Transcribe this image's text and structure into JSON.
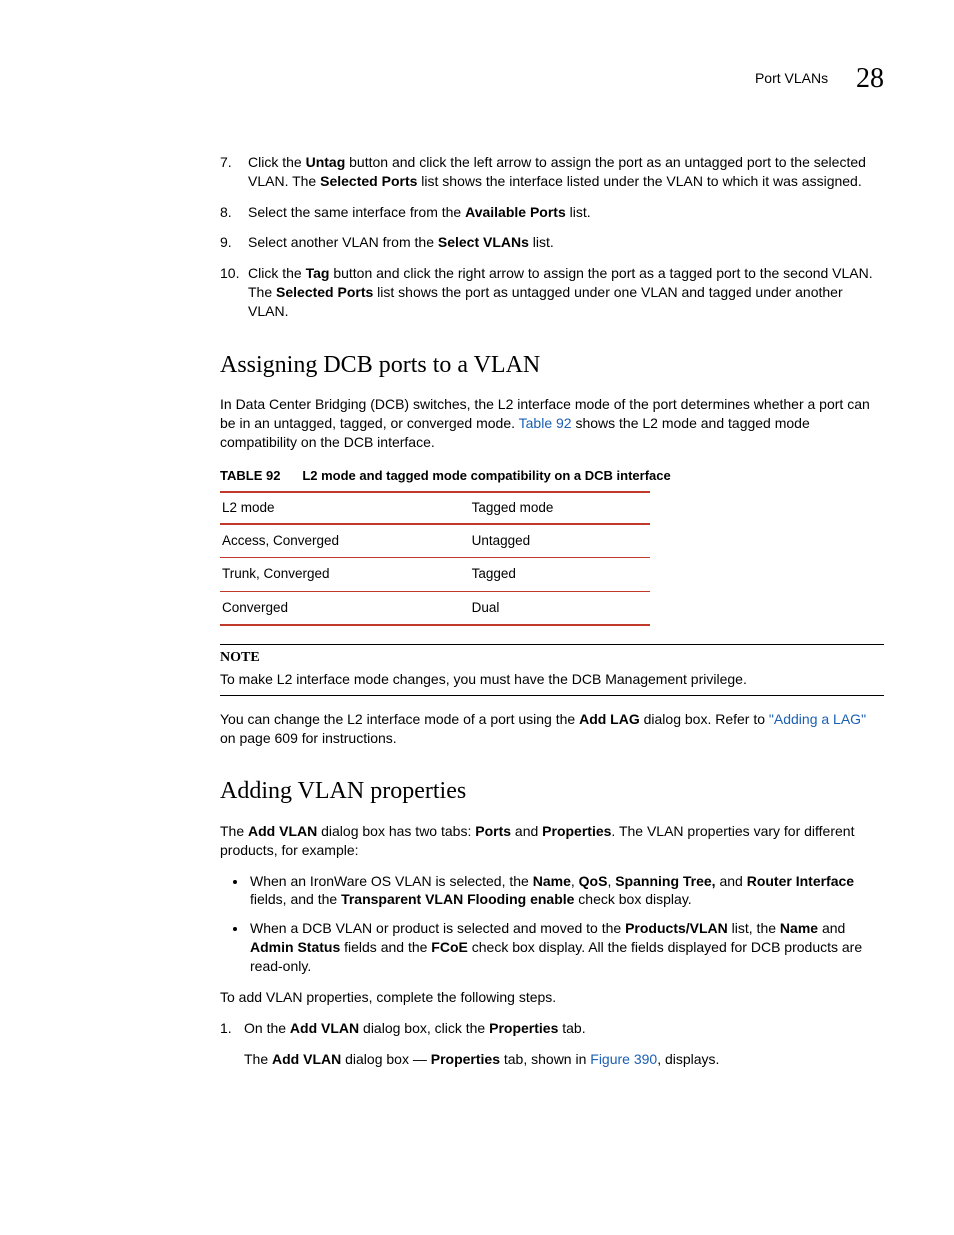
{
  "header": {
    "section": "Port VLANs",
    "chapter": "28"
  },
  "steps": [
    {
      "n": "7.",
      "parts": [
        {
          "t": "Click the "
        },
        {
          "t": "Untag",
          "b": true
        },
        {
          "t": " button and click the left arrow to assign the port as an untagged port to the selected VLAN. The "
        },
        {
          "t": "Selected Ports",
          "b": true
        },
        {
          "t": " list shows the interface listed under the VLAN to which it was assigned."
        }
      ]
    },
    {
      "n": "8.",
      "parts": [
        {
          "t": "Select the same interface from the "
        },
        {
          "t": "Available Ports",
          "b": true
        },
        {
          "t": " list."
        }
      ]
    },
    {
      "n": "9.",
      "parts": [
        {
          "t": "Select another VLAN from the "
        },
        {
          "t": "Select VLANs",
          "b": true
        },
        {
          "t": " list."
        }
      ]
    },
    {
      "n": "10.",
      "parts": [
        {
          "t": "Click the "
        },
        {
          "t": "Tag",
          "b": true
        },
        {
          "t": " button and click the right arrow to assign the port as a tagged port to the second VLAN. The "
        },
        {
          "t": "Selected Ports",
          "b": true
        },
        {
          "t": " list shows the port as untagged under one VLAN and tagged under another VLAN."
        }
      ]
    }
  ],
  "sec1": {
    "title": "Assigning DCB ports to a VLAN",
    "intro_parts": [
      {
        "t": "In Data Center Bridging (DCB) switches, the L2 interface mode of the port determines whether a port can be in an untagged, tagged, or converged mode. "
      },
      {
        "t": "Table 92",
        "link": true
      },
      {
        "t": " shows the L2 mode and tagged mode compatibility on the DCB interface."
      }
    ],
    "table": {
      "label": "TABLE 92",
      "caption": "L2 mode and tagged mode compatibility on a DCB interface",
      "head": [
        "L2 mode",
        "Tagged mode"
      ],
      "rows": [
        [
          "Access, Converged",
          "Untagged"
        ],
        [
          "Trunk, Converged",
          "Tagged"
        ],
        [
          "Converged",
          "Dual"
        ]
      ]
    },
    "note": {
      "label": "NOTE",
      "text": "To make L2 interface mode changes, you must have the DCB Management privilege."
    },
    "after_note_parts": [
      {
        "t": "You can change the L2 interface mode of a port using the "
      },
      {
        "t": "Add LAG",
        "b": true
      },
      {
        "t": " dialog box. Refer to "
      },
      {
        "t": "\"Adding a LAG\"",
        "link": true
      },
      {
        "t": " on page 609 for instructions."
      }
    ]
  },
  "sec2": {
    "title": "Adding VLAN properties",
    "intro_parts": [
      {
        "t": "The "
      },
      {
        "t": "Add VLAN",
        "b": true
      },
      {
        "t": " dialog box has two tabs: "
      },
      {
        "t": "Ports",
        "b": true
      },
      {
        "t": " and "
      },
      {
        "t": "Properties",
        "b": true
      },
      {
        "t": ". The VLAN properties vary for different products, for example:"
      }
    ],
    "bullets": [
      [
        {
          "t": "When an IronWare OS VLAN is selected, the "
        },
        {
          "t": "Name",
          "b": true
        },
        {
          "t": ", "
        },
        {
          "t": "QoS",
          "b": true
        },
        {
          "t": ", "
        },
        {
          "t": "Spanning Tree,",
          "b": true
        },
        {
          "t": " and "
        },
        {
          "t": "Router Interface",
          "b": true
        },
        {
          "t": " fields, and the "
        },
        {
          "t": "Transparent VLAN Flooding enable",
          "b": true
        },
        {
          "t": " check box display."
        }
      ],
      [
        {
          "t": "When a DCB VLAN or product is selected and moved to the "
        },
        {
          "t": "Products/VLAN",
          "b": true
        },
        {
          "t": " list, the "
        },
        {
          "t": "Name",
          "b": true
        },
        {
          "t": " and "
        },
        {
          "t": "Admin Status",
          "b": true
        },
        {
          "t": " fields and the "
        },
        {
          "t": "FCoE",
          "b": true
        },
        {
          "t": " check box display. All the fields displayed for DCB products are read-only."
        }
      ]
    ],
    "lead": "To add VLAN properties, complete the following steps.",
    "numstep": {
      "n": "1.",
      "parts": [
        {
          "t": "On the "
        },
        {
          "t": "Add VLAN",
          "b": true
        },
        {
          "t": " dialog box, click the "
        },
        {
          "t": "Properties",
          "b": true
        },
        {
          "t": " tab."
        }
      ],
      "follow_parts": [
        {
          "t": "The "
        },
        {
          "t": "Add VLAN",
          "b": true
        },
        {
          "t": " dialog box — "
        },
        {
          "t": "Properties",
          "b": true
        },
        {
          "t": " tab, shown in "
        },
        {
          "t": "Figure 390",
          "link": true
        },
        {
          "t": ", displays."
        }
      ]
    }
  }
}
